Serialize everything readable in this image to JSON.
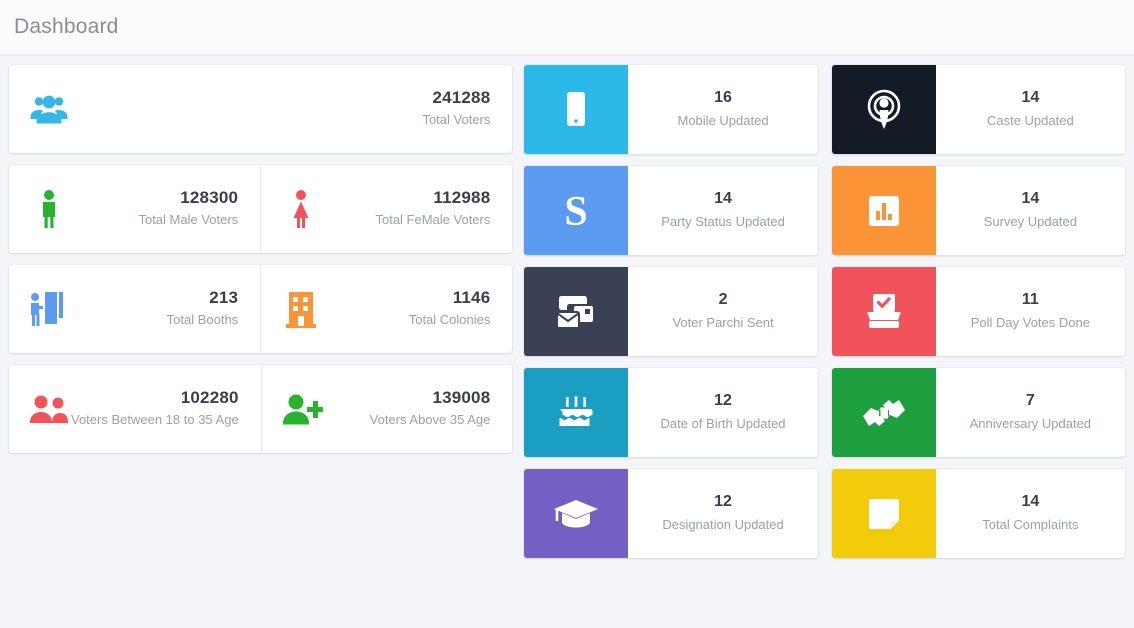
{
  "header": {
    "title": "Dashboard"
  },
  "left_column": {
    "rows": [
      {
        "cells": [
          {
            "icon": "group-people-icon",
            "icon_color": "#36b6e8",
            "value": "241288",
            "label": "Total Voters"
          }
        ]
      },
      {
        "cells": [
          {
            "icon": "male-person-icon",
            "icon_color": "#27b32e",
            "value": "128300",
            "label": "Total Male Voters"
          },
          {
            "icon": "female-person-icon",
            "icon_color": "#f2535b",
            "value": "112988",
            "label": "Total FeMale Voters"
          }
        ]
      },
      {
        "cells": [
          {
            "icon": "voting-booth-icon",
            "icon_color": "#5b9cf0",
            "value": "213",
            "label": "Total Booths"
          },
          {
            "icon": "building-icon",
            "icon_color": "#fb9337",
            "value": "1146",
            "label": "Total Colonies"
          }
        ]
      },
      {
        "cells": [
          {
            "icon": "two-people-icon",
            "icon_color": "#f2535b",
            "value": "102280",
            "label": "Voters Between 18 to 35 Age"
          },
          {
            "icon": "person-plus-icon",
            "icon_color": "#27b32e",
            "value": "139008",
            "label": "Voters Above 35 Age"
          }
        ]
      }
    ]
  },
  "middle_column": {
    "tiles": [
      {
        "icon": "mobile-phone-icon",
        "tile_color": "#2cb8e8",
        "value": "16",
        "label": "Mobile Updated"
      },
      {
        "icon": "letter-s-icon",
        "tile_color": "#5b9cf0",
        "value": "14",
        "label": "Party Status Updated"
      },
      {
        "icon": "mail-stack-icon",
        "tile_color": "#3b4154",
        "value": "2",
        "label": "Voter Parchi Sent"
      },
      {
        "icon": "birthday-cake-icon",
        "tile_color": "#1a9fc2",
        "value": "12",
        "label": "Date of Birth Updated"
      },
      {
        "icon": "graduation-cap-icon",
        "tile_color": "#7460c4",
        "value": "12",
        "label": "Designation Updated"
      }
    ]
  },
  "right_column": {
    "tiles": [
      {
        "icon": "broadcast-icon",
        "tile_color": "#141b26",
        "value": "14",
        "label": "Caste Updated"
      },
      {
        "icon": "bar-chart-report-icon",
        "tile_color": "#fb9337",
        "value": "14",
        "label": "Survey Updated"
      },
      {
        "icon": "ballot-box-icon",
        "tile_color": "#f2535b",
        "value": "11",
        "label": "Poll Day Votes Done"
      },
      {
        "icon": "handshake-icon",
        "tile_color": "#1d9e3f",
        "value": "7",
        "label": "Anniversary Updated"
      },
      {
        "icon": "note-page-icon",
        "tile_color": "#f2cb0b",
        "value": "14",
        "label": "Total Complaints"
      }
    ]
  }
}
